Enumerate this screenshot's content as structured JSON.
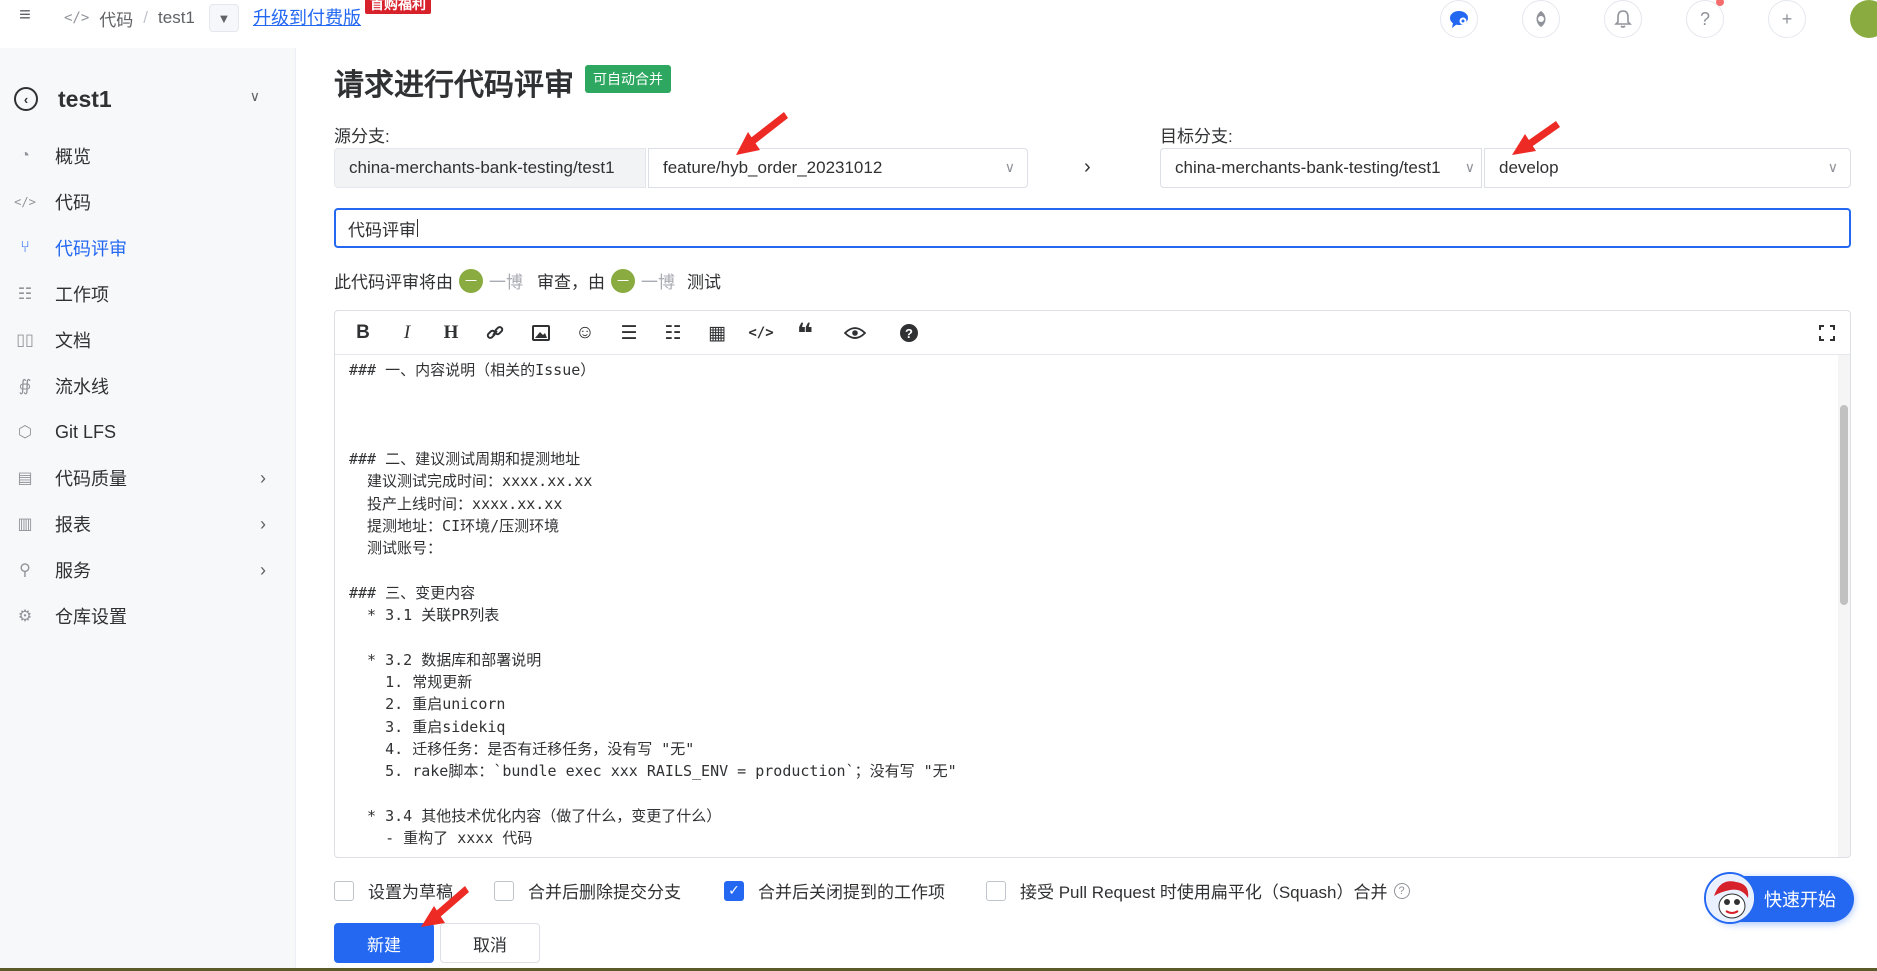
{
  "topbar": {
    "breadcrumb_section": "代码",
    "breadcrumb_repo": "test1",
    "upgrade_link": "升级到付费版",
    "promo_badge": "首购福利",
    "icons": [
      "chat-icon",
      "user-center-icon",
      "bell-icon",
      "help-icon",
      "plus-icon"
    ]
  },
  "sidebar": {
    "repo_name": "test1",
    "items": [
      {
        "label": "概览",
        "icon": "gauge-icon"
      },
      {
        "label": "代码",
        "icon": "code-icon"
      },
      {
        "label": "代码评审",
        "icon": "merge-request-icon",
        "active": true
      },
      {
        "label": "工作项",
        "icon": "task-icon"
      },
      {
        "label": "文档",
        "icon": "book-icon"
      },
      {
        "label": "流水线",
        "icon": "pipeline-icon"
      },
      {
        "label": "Git LFS",
        "icon": "cube-icon"
      },
      {
        "label": "代码质量",
        "icon": "quality-icon",
        "has_children": true
      },
      {
        "label": "报表",
        "icon": "chart-icon",
        "has_children": true
      },
      {
        "label": "服务",
        "icon": "service-icon",
        "has_children": true
      },
      {
        "label": "仓库设置",
        "icon": "gear-icon"
      }
    ]
  },
  "main": {
    "title": "请求进行代码评审",
    "auto_merge_badge": "可自动合并",
    "source_label": "源分支:",
    "source_repo": "china-merchants-bank-testing/test1",
    "source_branch": "feature/hyb_order_20231012",
    "target_label": "目标分支:",
    "target_repo": "china-merchants-bank-testing/test1",
    "target_branch": "develop",
    "pr_title": "代码评审",
    "review_text_1": "此代码评审将由",
    "reviewer_name": "一博",
    "review_text_2": "审查，由",
    "tester_name": "一博",
    "review_text_3": "测试",
    "reviewer_avatar_text": "一",
    "editor_body": "### 一、内容说明（相关的Issue）\n\n\n\n### 二、建议测试周期和提测地址\n  建议测试完成时间：xxxx.xx.xx\n  投产上线时间：xxxx.xx.xx\n  提测地址：CI环境/压测环境\n  测试账号：\n\n### 三、变更内容\n  * 3.1 关联PR列表\n\n  * 3.2 数据库和部署说明\n    1. 常规更新\n    2. 重启unicorn\n    3. 重启sidekiq\n    4. 迁移任务：是否有迁移任务，没有写 \"无\"\n    5. rake脚本：`bundle exec xxx RAILS_ENV = production`；没有写 \"无\"\n\n  * 3.4 其他技术优化内容（做了什么，变更了什么）\n    - 重构了 xxxx 代码",
    "toolbar_icons": [
      "bold-icon",
      "italic-icon",
      "heading-icon",
      "link-icon",
      "image-icon",
      "emoji-icon",
      "bullet-list-icon",
      "ordered-list-icon",
      "table-icon",
      "code-icon",
      "quote-icon",
      "preview-icon",
      "help-icon",
      "fullscreen-icon"
    ],
    "options": [
      {
        "label": "设置为草稿",
        "checked": false
      },
      {
        "label": "合并后删除提交分支",
        "checked": false
      },
      {
        "label": "合并后关闭提到的工作项",
        "checked": true
      },
      {
        "label": "接受 Pull Request 时使用扁平化（Squash）合并",
        "checked": false
      }
    ],
    "create_button": "新建",
    "cancel_button": "取消"
  },
  "quick_start": "快速开始",
  "colors": {
    "primary": "#2468f2",
    "success": "#2ea860",
    "promo": "#d7222c",
    "annotation_arrow": "#ee2a24"
  }
}
